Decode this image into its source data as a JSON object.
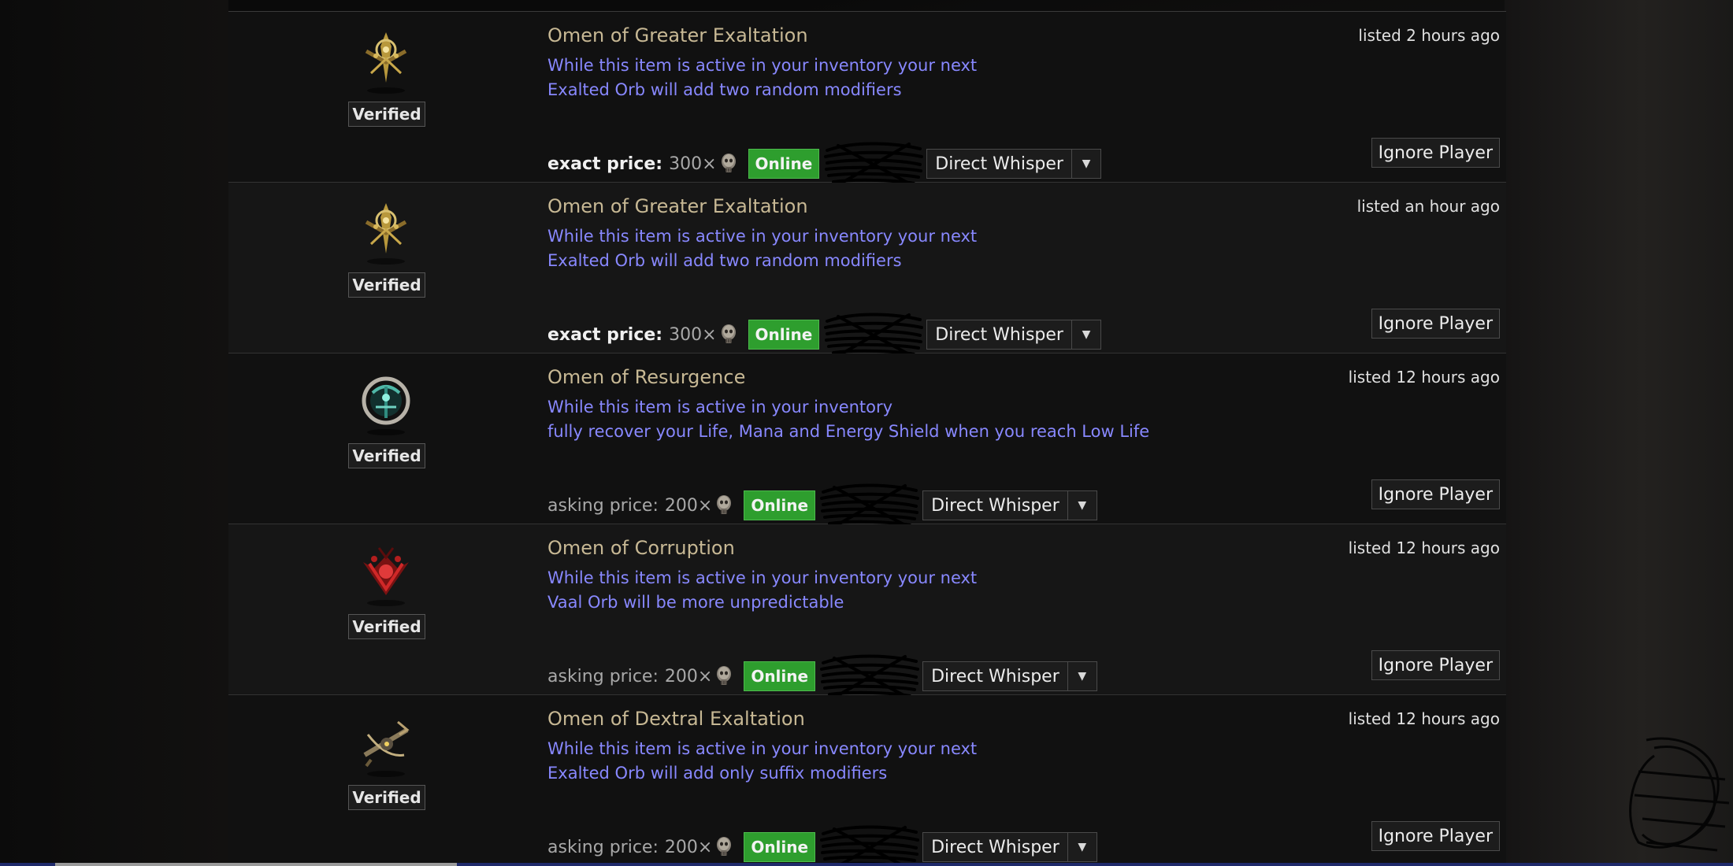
{
  "listings": [
    {
      "name": "Omen of Greater Exaltation",
      "mods": [
        "While this item is active in your inventory your next",
        "Exalted Orb will add two random modifiers"
      ],
      "listed": "listed 2 hours ago",
      "verified": "Verified",
      "price_label": "exact price:",
      "price_type": "exact",
      "price_value": "300×",
      "status": "Online",
      "whisper": "Direct Whisper",
      "ignore": "Ignore Player",
      "icon": "omen-greater-exaltation-icon"
    },
    {
      "name": "Omen of Greater Exaltation",
      "mods": [
        "While this item is active in your inventory your next",
        "Exalted Orb will add two random modifiers"
      ],
      "listed": "listed an hour ago",
      "verified": "Verified",
      "price_label": "exact price:",
      "price_type": "exact",
      "price_value": "300×",
      "status": "Online",
      "whisper": "Direct Whisper",
      "ignore": "Ignore Player",
      "icon": "omen-greater-exaltation-icon"
    },
    {
      "name": "Omen of Resurgence",
      "mods": [
        "While this item is active in your inventory",
        "fully recover your Life, Mana and Energy Shield when you reach Low Life"
      ],
      "listed": "listed 12 hours ago",
      "verified": "Verified",
      "price_label": "asking price:",
      "price_type": "asking",
      "price_value": "200×",
      "status": "Online",
      "whisper": "Direct Whisper",
      "ignore": "Ignore Player",
      "icon": "omen-resurgence-icon"
    },
    {
      "name": "Omen of Corruption",
      "mods": [
        "While this item is active in your inventory your next",
        "Vaal Orb will be more unpredictable"
      ],
      "listed": "listed 12 hours ago",
      "verified": "Verified",
      "price_label": "asking price:",
      "price_type": "asking",
      "price_value": "200×",
      "status": "Online",
      "whisper": "Direct Whisper",
      "ignore": "Ignore Player",
      "icon": "omen-corruption-icon"
    },
    {
      "name": "Omen of Dextral Exaltation",
      "mods": [
        "While this item is active in your inventory your next",
        "Exalted Orb will add only suffix modifiers"
      ],
      "listed": "listed 12 hours ago",
      "verified": "Verified",
      "price_label": "asking price:",
      "price_type": "asking",
      "price_value": "200×",
      "status": "Online",
      "whisper": "Direct Whisper",
      "ignore": "Ignore Player",
      "icon": "omen-dextral-exaltation-icon"
    }
  ],
  "colors": {
    "item_name": "#c7b894",
    "mod_text": "#8888ff",
    "online_bg": "#2e9e2e"
  },
  "currency_icon": "divine-skull-currency-icon"
}
